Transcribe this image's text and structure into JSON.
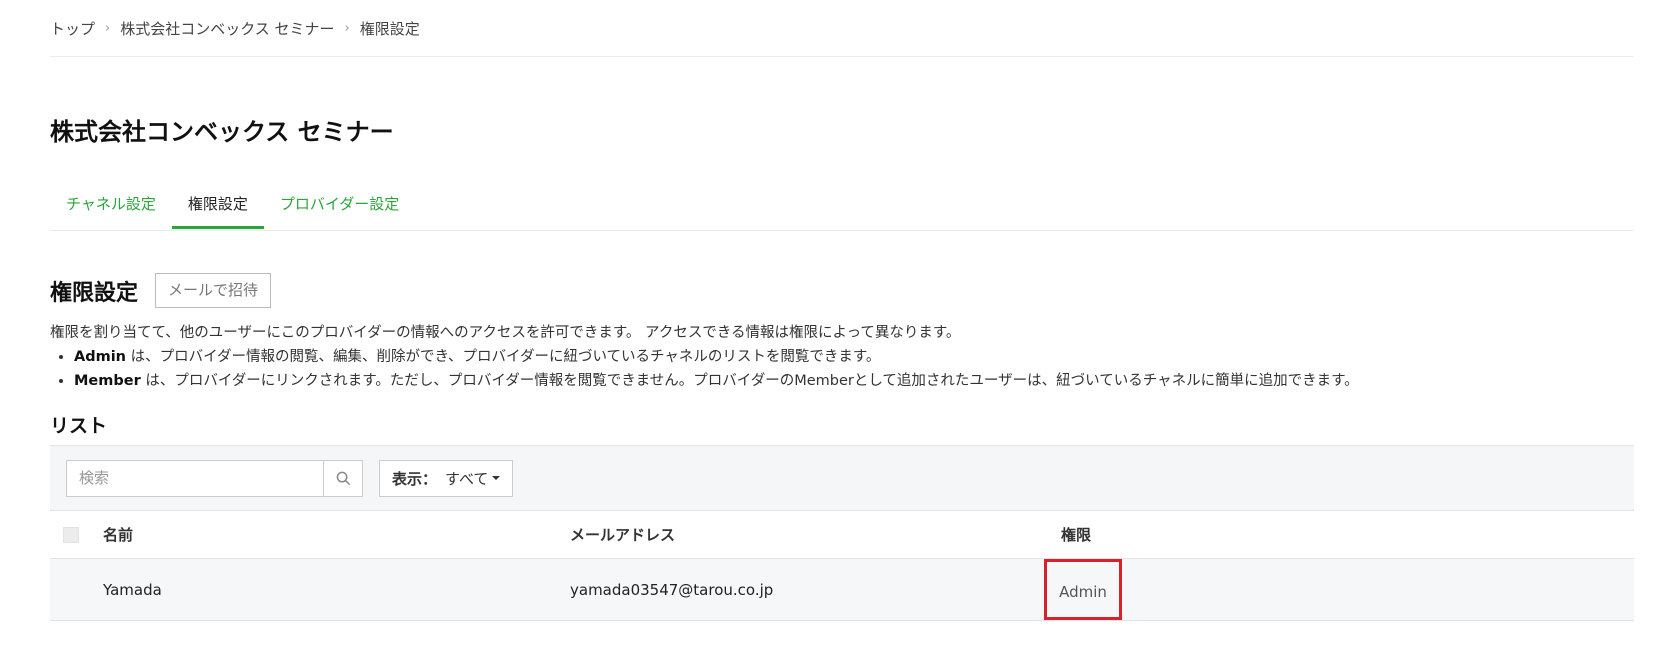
{
  "breadcrumb": {
    "items": [
      "トップ",
      "株式会社コンベックス セミナー",
      "権限設定"
    ],
    "separator": "›"
  },
  "page": {
    "title": "株式会社コンベックス セミナー"
  },
  "tabs": [
    {
      "label": "チャネル設定",
      "active": false
    },
    {
      "label": "権限設定",
      "active": true
    },
    {
      "label": "プロバイダー設定",
      "active": false
    }
  ],
  "section": {
    "title": "権限設定",
    "invite_button": "メールで招待",
    "description": "権限を割り当てて、他のユーザーにこのプロバイダーの情報へのアクセスを許可できます。 アクセスできる情報は権限によって異なります。",
    "bullets": [
      {
        "role": "Admin",
        "text": " は、プロバイダー情報の閲覧、編集、削除ができ、プロバイダーに紐づいているチャネルのリストを閲覧できます。"
      },
      {
        "role": "Member",
        "text": " は、プロバイダーにリンクされます。ただし、プロバイダー情報を閲覧できません。プロバイダーのMemberとして追加されたユーザーは、紐づいているチャネルに簡単に追加できます。"
      }
    ]
  },
  "list": {
    "title": "リスト",
    "search": {
      "placeholder": "検索",
      "value": ""
    },
    "filter": {
      "label": "表示：",
      "value": "すべて"
    },
    "columns": [
      "名前",
      "メールアドレス",
      "権限"
    ],
    "rows": [
      {
        "name": "Yamada",
        "email": "yamada03547@tarou.co.jp",
        "role": "Admin"
      }
    ]
  },
  "colors": {
    "accent": "#2aa53a",
    "highlight": "#d6222a"
  }
}
